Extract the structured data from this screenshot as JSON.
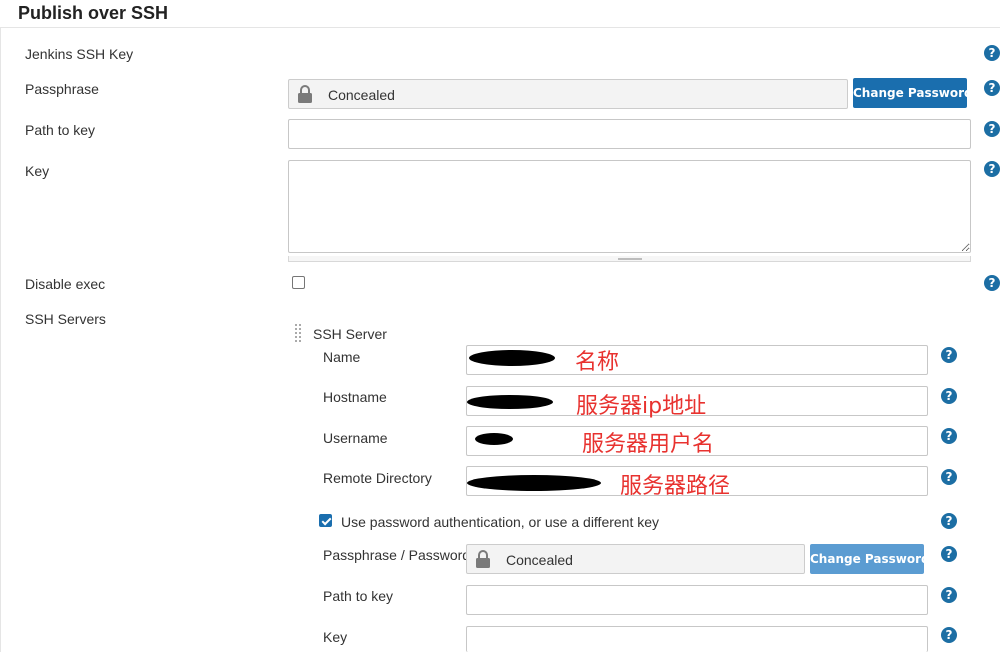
{
  "section": {
    "title": "Publish over SSH"
  },
  "fields": {
    "jenkins_ssh_key": {
      "label": "Jenkins SSH Key"
    },
    "passphrase": {
      "label": "Passphrase",
      "value": "Concealed",
      "button": "Change Password"
    },
    "path_to_key": {
      "label": "Path to key",
      "value": ""
    },
    "key": {
      "label": "Key",
      "value": ""
    },
    "disable_exec": {
      "label": "Disable exec",
      "checked": false
    },
    "ssh_servers": {
      "label": "SSH Servers"
    }
  },
  "ssh_server": {
    "header": "SSH Server",
    "name": {
      "label": "Name",
      "annotation": "名称"
    },
    "hostname": {
      "label": "Hostname",
      "annotation": "服务器ip地址"
    },
    "username": {
      "label": "Username",
      "annotation": "服务器用户名"
    },
    "remote_directory": {
      "label": "Remote Directory",
      "annotation": "服务器路径"
    },
    "use_password": {
      "label": "Use password authentication, or use a different key",
      "checked": true
    },
    "passphrase_password": {
      "label": "Passphrase / Password",
      "value": "Concealed",
      "button": "Change Password"
    },
    "path_to_key": {
      "label": "Path to key",
      "value": ""
    },
    "key": {
      "label": "Key",
      "value": ""
    }
  },
  "icons": {
    "help": "?",
    "help_icon": "help-icon",
    "lock_icon": "lock-icon",
    "drag_icon": "drag-handle-icon"
  },
  "colors": {
    "help": "#1c6ea4",
    "button_primary": "#1a6eae",
    "button_secondary": "#5b9cd2",
    "annotation": "#e8322f"
  }
}
